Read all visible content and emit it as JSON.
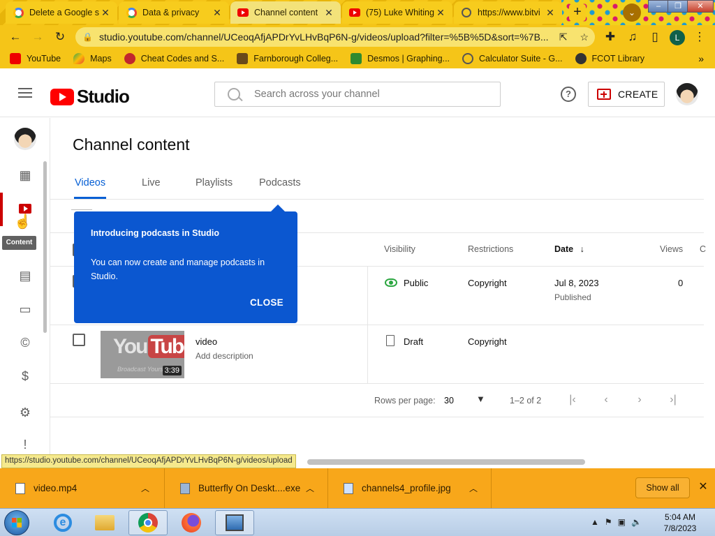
{
  "browser": {
    "tabs": [
      {
        "title": "Delete a Google s",
        "favicon": "google-icon",
        "active": false
      },
      {
        "title": "Data & privacy",
        "favicon": "google-icon",
        "active": false
      },
      {
        "title": "Channel content",
        "favicon": "youtube-icon",
        "active": true
      },
      {
        "title": "(75) Luke Whiting",
        "favicon": "youtube-icon",
        "active": false
      },
      {
        "title": "https://www.bitvi",
        "favicon": "globe-icon",
        "active": false
      }
    ],
    "url": "studio.youtube.com/channel/UCeoqAfjAPDrYvLHvBqP6N-g/videos/upload?filter=%5B%5D&sort=%7B...",
    "profile_initial": "L",
    "bookmarks": [
      {
        "label": "YouTube",
        "icon": "youtube-icon"
      },
      {
        "label": "Maps",
        "icon": "maps-icon"
      },
      {
        "label": "Cheat Codes and S...",
        "icon": "bookmark-icon"
      },
      {
        "label": "Farnborough Colleg...",
        "icon": "bookmark-icon"
      },
      {
        "label": "Desmos | Graphing...",
        "icon": "desmos-icon"
      },
      {
        "label": "Calculator Suite - G...",
        "icon": "geogebra-icon"
      },
      {
        "label": "FCOT Library",
        "icon": "globe-icon"
      }
    ],
    "status_url": "https://studio.youtube.com/channel/UCeoqAfjAPDrYvLHvBqP6N-g/videos/upload"
  },
  "studio": {
    "logo_text": "Studio",
    "search_placeholder": "Search across your channel",
    "create_label": "CREATE",
    "nav_tooltip": "Content",
    "page_title": "Channel content",
    "tabs": [
      "Videos",
      "Live",
      "Playlists",
      "Podcasts"
    ],
    "active_tab": "Videos",
    "columns": {
      "visibility": "Visibility",
      "restrictions": "Restrictions",
      "date": "Date",
      "views": "Views",
      "comments": "C"
    },
    "rows": [
      {
        "title": "",
        "description": "",
        "visibility": "Public",
        "restrictions": "Copyright",
        "date": "Jul 8, 2023",
        "date_status": "Published",
        "views": "0"
      },
      {
        "title": "video",
        "description": "Add description",
        "duration": "3:39",
        "visibility": "Draft",
        "restrictions": "Copyright",
        "date": "",
        "date_status": "",
        "views": ""
      }
    ],
    "thumbnail": {
      "brand_left": "You",
      "brand_right": "Tube",
      "tagline": "Broadcast Yours"
    },
    "pager": {
      "rows_per_page_label": "Rows per page:",
      "rows_per_page_value": "30",
      "range": "1–2 of 2"
    },
    "popup": {
      "heading": "Introducing podcasts in Studio",
      "body": "You can now create and manage podcasts in Studio.",
      "close_label": "CLOSE",
      "color": "#0b57d0"
    }
  },
  "downloads": {
    "items": [
      "video.mp4",
      "Butterfly On Deskt....exe",
      "channels4_profile.jpg"
    ],
    "show_all": "Show all"
  },
  "taskbar": {
    "time": "5:04 AM",
    "date": "7/8/2023"
  },
  "colors": {
    "accent_blue": "#065fd4",
    "brand_red": "#ff0000",
    "public_green": "#2ba640",
    "browser_theme": "#f5c518"
  }
}
